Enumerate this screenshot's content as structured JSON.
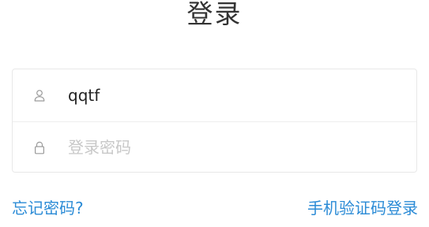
{
  "page": {
    "title": "登录"
  },
  "form": {
    "username": {
      "icon": "user-icon",
      "value": "qqtf"
    },
    "password": {
      "icon": "lock-icon",
      "value": "",
      "placeholder": "登录密码"
    }
  },
  "links": {
    "forgot_password": "忘记密码?",
    "sms_login": "手机验证码登录"
  },
  "colors": {
    "link": "#2b8bd6",
    "title": "#333333",
    "border": "#e8e8e8",
    "placeholder": "#c8c8c8"
  }
}
